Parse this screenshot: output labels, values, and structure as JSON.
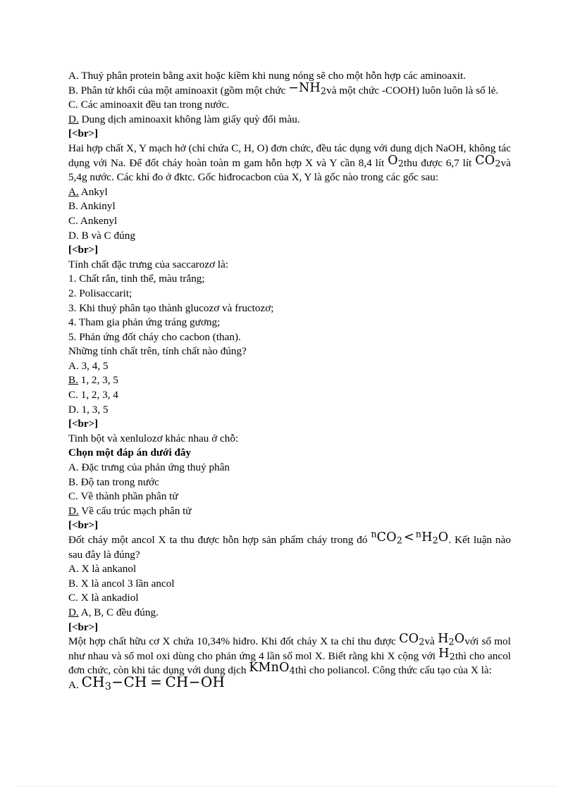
{
  "document": {
    "language": "vi",
    "subject": "Hoa hoc",
    "separator_label": "[<br>]",
    "colors": {
      "text": "#000000",
      "background": "#ffffff",
      "rule": "#f3b9da"
    }
  },
  "block1": {
    "options": [
      {
        "letter": "A.",
        "underlined": false,
        "text": "Thuỷ phân protein bằng axit hoặc kiềm khi nung nóng sẽ cho một hỗn hợp các aminoaxit."
      },
      {
        "letter": "B.",
        "underlined": false,
        "text_before": "Phân tử khối của một aminoaxit  (gồm một chức ",
        "formula": "−NH2",
        "text_after": "và một chức -COOH) luôn luôn là số lẻ."
      },
      {
        "letter": "C.",
        "underlined": false,
        "text": "Các aminoaxit  đều tan trong nước."
      },
      {
        "letter": "D.",
        "underlined": true,
        "text": "Dung dịch aminoaxit  không làm giấy quỳ đổi màu."
      }
    ]
  },
  "block2": {
    "stem_part1": "Hai hợp chất X, Y mạch hở (chỉ chứa C, H, O) đơn chức, đều tác dụng với dung dịch NaOH, không tác dụng với Na. Để đốt cháy hoàn toàn m gam hỗn hợp X và Y cần 8,4 lít ",
    "formula1": "O2",
    "stem_part2": "thu được 6,7 lít ",
    "formula2": "CO2",
    "stem_part3": "và 5,4g nước. Các khí đo ở đktc. Gốc hiđrocacbon  của X, Y là gốc nào trong các gốc sau:",
    "options": [
      {
        "letter": "A.",
        "underlined": true,
        "text": "Ankyl"
      },
      {
        "letter": "B.",
        "underlined": false,
        "text": "Ankinyl"
      },
      {
        "letter": "C.",
        "underlined": false,
        "text": "Ankenyl"
      },
      {
        "letter": "D.",
        "underlined": false,
        "text": "B và C đúng"
      }
    ]
  },
  "block3": {
    "stem": "Tính  chất đặc trưng của saccarozơ là:",
    "statements": [
      "1. Chất rắn, tinh  thể, màu  trắng;",
      "2. Polisaccarit;",
      "3. Khi thuỷ phân tạo thành  glucozơ  và fructozơ;",
      "4. Tham  gia phản ứng tráng  gương;",
      "5. Phản ứng đốt cháy cho cacbon (than)."
    ],
    "question": "Những tính  chất trên, tính  chất nào đúng?",
    "options": [
      {
        "letter": "A.",
        "underlined": false,
        "text": "3, 4, 5"
      },
      {
        "letter": "B.",
        "underlined": true,
        "text": "1, 2, 3, 5"
      },
      {
        "letter": "C.",
        "underlined": false,
        "text": "1, 2, 3, 4"
      },
      {
        "letter": "D.",
        "underlined": false,
        "text": "1, 3, 5"
      }
    ]
  },
  "block4": {
    "stem": "Tinh  bột và xenlulozơ  khác nhau  ở chỗ:",
    "instruction": "Chọn một đáp án dưới đây",
    "options": [
      {
        "letter": "A.",
        "underlined": false,
        "text": "Đặc trưng  của phản ứng thuỷ  phân"
      },
      {
        "letter": "B.",
        "underlined": false,
        "text": "Độ tan trong nước"
      },
      {
        "letter": "C.",
        "underlined": false,
        "text": "Về thành  phần phân tử"
      },
      {
        "letter": "D.",
        "underlined": true,
        "text": "Về cấu trúc mạch  phân tử"
      }
    ]
  },
  "block5": {
    "stem_part1": "Đốt cháy một ancol X ta thu được hỗn hợp sản phẩm  cháy trong đó ",
    "formula_inequality": "nCO2 < nH2O",
    "stem_part2": ". Kết luận nào sau đây là đúng?",
    "options": [
      {
        "letter": "A.",
        "underlined": false,
        "text": "X là ankanol"
      },
      {
        "letter": "B.",
        "underlined": false,
        "text": "X là ancol 3 lần  ancol"
      },
      {
        "letter": "C.",
        "underlined": false,
        "text": "X là ankadiol"
      },
      {
        "letter": "D.",
        "underlined": true,
        "text": "A, B, C đều đúng."
      }
    ]
  },
  "block6": {
    "stem_part1": "Một hợp chất hữu cơ X chứa 10,34% hiđro.  Khi đốt cháy X ta chỉ thu được ",
    "formula1": "CO2",
    "stem_part2": "và ",
    "formula2": "H2O",
    "stem_part3": "với số mol như nhau và số mol oxi dùng cho phản ứng 4 lần  số mol X. Biết rằng khi X cộng với ",
    "formula3": "H2",
    "stem_part4": "thì cho ancol đơn chức, còn khi tác dụng với  dung dịch ",
    "formula4": "KMnO4",
    "stem_part5": "thì cho poliancol.  Công thức cấu tạo của X là:",
    "options": [
      {
        "letter": "A.",
        "underlined": false,
        "formula": "CH3−CH = CH−OH"
      }
    ]
  }
}
